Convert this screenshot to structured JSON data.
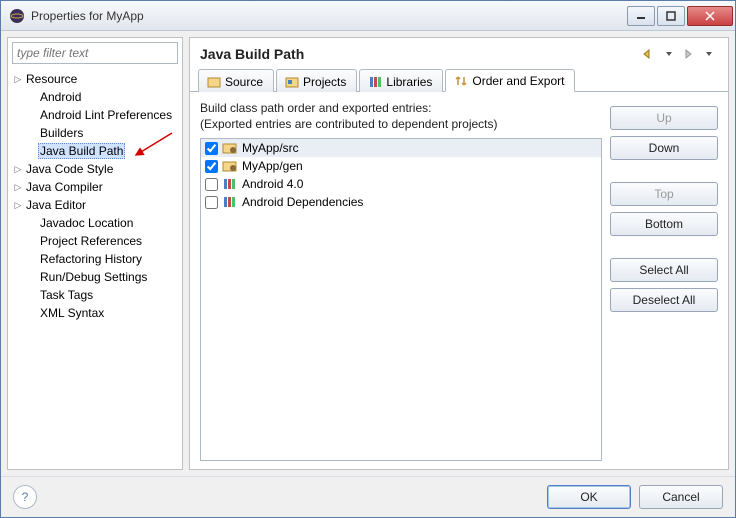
{
  "window": {
    "title": "Properties for MyApp"
  },
  "filter": {
    "placeholder": "type filter text"
  },
  "tree": [
    {
      "label": "Resource",
      "expandable": true,
      "indent": false
    },
    {
      "label": "Android",
      "expandable": false,
      "indent": true
    },
    {
      "label": "Android Lint Preferences",
      "expandable": false,
      "indent": true
    },
    {
      "label": "Builders",
      "expandable": false,
      "indent": true
    },
    {
      "label": "Java Build Path",
      "expandable": false,
      "indent": true,
      "selected": true
    },
    {
      "label": "Java Code Style",
      "expandable": true,
      "indent": false
    },
    {
      "label": "Java Compiler",
      "expandable": true,
      "indent": false
    },
    {
      "label": "Java Editor",
      "expandable": true,
      "indent": false
    },
    {
      "label": "Javadoc Location",
      "expandable": false,
      "indent": true
    },
    {
      "label": "Project References",
      "expandable": false,
      "indent": true
    },
    {
      "label": "Refactoring History",
      "expandable": false,
      "indent": true
    },
    {
      "label": "Run/Debug Settings",
      "expandable": false,
      "indent": true
    },
    {
      "label": "Task Tags",
      "expandable": false,
      "indent": true
    },
    {
      "label": "XML Syntax",
      "expandable": false,
      "indent": true
    }
  ],
  "page": {
    "title": "Java Build Path",
    "desc_line1": "Build class path order and exported entries:",
    "desc_line2": "(Exported entries are contributed to dependent projects)"
  },
  "tabs": [
    {
      "label": "Source",
      "icon": "source-icon"
    },
    {
      "label": "Projects",
      "icon": "projects-icon"
    },
    {
      "label": "Libraries",
      "icon": "libraries-icon"
    },
    {
      "label": "Order and Export",
      "icon": "order-icon",
      "active": true
    }
  ],
  "entries": [
    {
      "label": "MyApp/src",
      "checked": true,
      "icon": "package-folder",
      "selected": true
    },
    {
      "label": "MyApp/gen",
      "checked": true,
      "icon": "package-folder"
    },
    {
      "label": "Android 4.0",
      "checked": false,
      "icon": "library"
    },
    {
      "label": "Android Dependencies",
      "checked": false,
      "icon": "library"
    }
  ],
  "buttons": {
    "up": "Up",
    "down": "Down",
    "top": "Top",
    "bottom": "Bottom",
    "select_all": "Select All",
    "deselect_all": "Deselect All"
  },
  "footer": {
    "ok": "OK",
    "cancel": "Cancel"
  }
}
